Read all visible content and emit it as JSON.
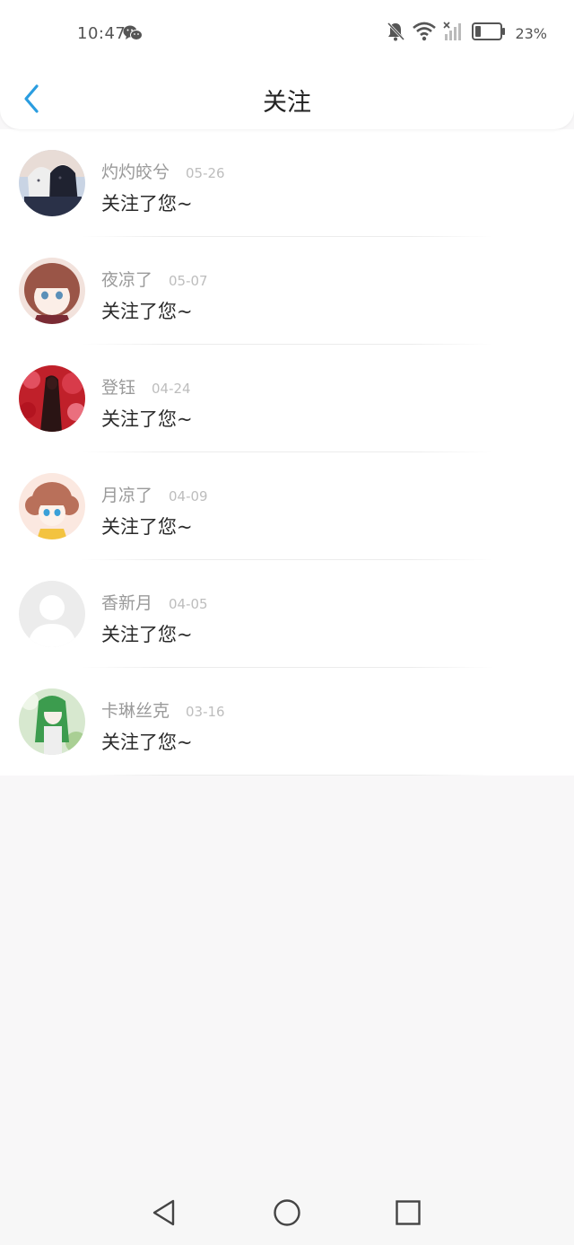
{
  "status_bar": {
    "time": "10:47",
    "battery_percent": "23%",
    "battery_level": 0.23,
    "icons": [
      "wechat-icon",
      "bell-off-icon",
      "wifi-icon",
      "signal-icon",
      "battery-icon"
    ]
  },
  "nav": {
    "title": "关注",
    "back_icon": "chevron-left-icon",
    "accent_color": "#2a9de0"
  },
  "notifications": [
    {
      "name": "灼灼皎兮",
      "date": "05-26",
      "message": "关注了您~",
      "avatar": "anime-girls-avatar"
    },
    {
      "name": "夜凉了",
      "date": "05-07",
      "message": "关注了您~",
      "avatar": "chibi-girl-avatar"
    },
    {
      "name": "登钰",
      "date": "04-24",
      "message": "关注了您~",
      "avatar": "red-scene-avatar"
    },
    {
      "name": "月凉了",
      "date": "04-09",
      "message": "关注了您~",
      "avatar": "chibi-girl-avatar"
    },
    {
      "name": "香新月",
      "date": "04-05",
      "message": "关注了您~",
      "avatar": "default-person-avatar"
    },
    {
      "name": "卡琳丝克",
      "date": "03-16",
      "message": "关注了您~",
      "avatar": "green-hair-girl-avatar"
    }
  ],
  "system_nav": {
    "back": "triangle-back-icon",
    "home": "circle-home-icon",
    "recents": "square-recents-icon"
  }
}
